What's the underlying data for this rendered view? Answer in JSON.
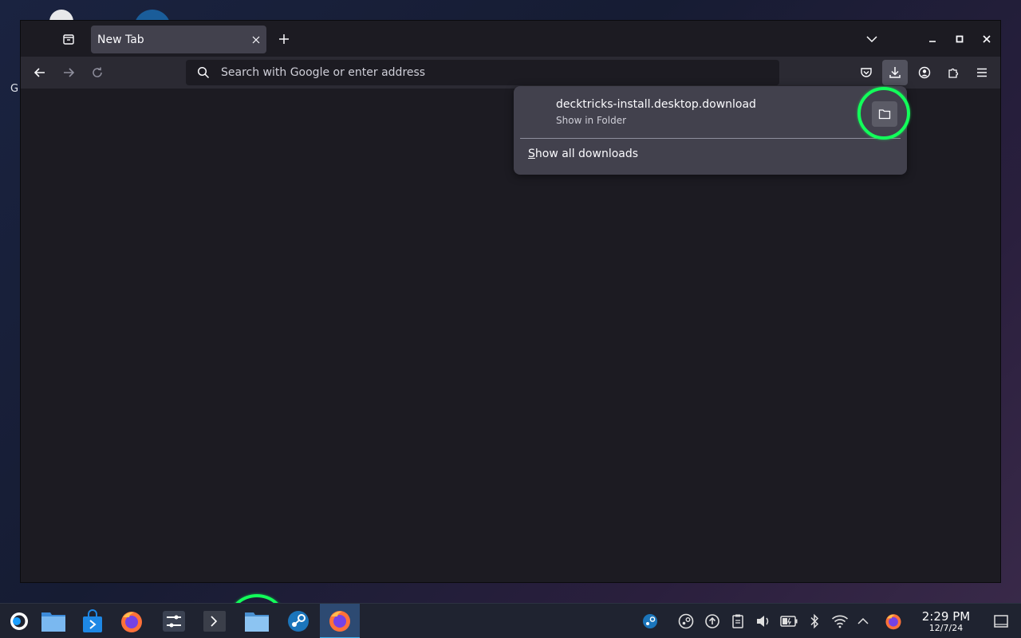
{
  "desktop": {
    "letter": "G"
  },
  "browser": {
    "tab": {
      "title": "New Tab"
    },
    "urlbar": {
      "placeholder": "Search with Google or enter address"
    },
    "downloads_panel": {
      "item": {
        "filename": "decktricks-install.desktop.download",
        "status": "Show in Folder"
      },
      "show_all_label_first": "S",
      "show_all_label_rest": "how all downloads"
    }
  },
  "taskbar": {
    "clock": {
      "time": "2:29 PM",
      "date": "12/7/24"
    }
  },
  "colors": {
    "highlight": "#12ff5a",
    "panel_bg": "#42414d",
    "window_bg": "#1c1b22",
    "toolbar_bg": "#2b2a33"
  }
}
